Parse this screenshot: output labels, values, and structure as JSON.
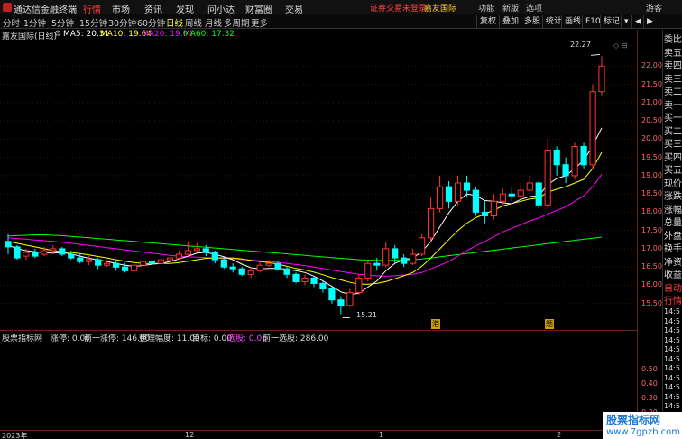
{
  "titlebar": {
    "app_title": "通达信金融终端",
    "menus": [
      "行情",
      "市场",
      "资讯",
      "发现",
      "问小达",
      "财富圈",
      "交易"
    ],
    "active_menu": "行情",
    "notice": "证券交易未登录",
    "notice2": "嘉友国际",
    "right_items": [
      "功能",
      "新版",
      "选项",
      "游客"
    ]
  },
  "toolbar": {
    "periods": [
      "分时",
      "1分钟",
      "5分钟",
      "15分钟",
      "30分钟",
      "60分钟",
      "日线",
      "周线",
      "月线",
      "多周期",
      "更多"
    ],
    "active_period": "日线",
    "buttons": [
      "复权",
      "叠加",
      "多股",
      "统计",
      "画线",
      "F10",
      "标记"
    ]
  },
  "legend": {
    "stock": "嘉友国际(日线)",
    "ma5": "MA5: 20.31",
    "ma10": "MA10: 19.64",
    "ma20": "MA20: 19.04",
    "ma60": "MA60: 17.32",
    "colors": {
      "ma5": "#ffffff",
      "ma10": "#ffff00",
      "ma20": "#ff00ff",
      "ma60": "#00ff00",
      "up": "#ff3232",
      "down": "#00ffff"
    }
  },
  "price_axis": {
    "ticks": [
      "22.00",
      "21.50",
      "21.00",
      "20.50",
      "20.00",
      "19.50",
      "19.00",
      "18.50",
      "18.00",
      "17.50",
      "17.00",
      "16.50",
      "16.00",
      "15.50"
    ],
    "ind_ticks": [
      "0.50",
      "0.40",
      "0.30",
      "0.20",
      "0.10"
    ]
  },
  "annotations": {
    "high": "22.27",
    "low": "15.21",
    "mark1": "港",
    "mark2": "题"
  },
  "indicator": {
    "name": "股票指标网",
    "zhangting": "涨停: 0.00",
    "qian_zhangting": "前一涨停: 146.00",
    "zhengli": "整理幅度: 11.00",
    "mubiao": "目标: 0.00",
    "xuangu": "选股: 0.00",
    "qian_xuangu": "前一选股: 286.00"
  },
  "bottom_axis": {
    "labels": [
      "2023年",
      "12",
      "1",
      "2"
    ]
  },
  "sidebar": {
    "items": [
      "委比",
      "卖五",
      "卖四",
      "卖三",
      "卖二",
      "卖一",
      "买一",
      "买二",
      "买三",
      "买四",
      "买五",
      "现价",
      "涨跌",
      "涨幅",
      "总量",
      "外盘",
      "换手",
      "净资",
      "收益",
      "自动",
      "行情"
    ],
    "times": [
      "14:5",
      "14:5",
      "14:5",
      "14:5",
      "14:5",
      "14:5",
      "14:5",
      "14:5",
      "14:5",
      "14:5",
      "14:5",
      "14:5",
      "14:5"
    ]
  },
  "watermark": {
    "line1": "股票指标网",
    "line2": "www.7gpzb.com"
  },
  "chart_data": {
    "type": "candlestick",
    "title": "嘉友国际(日线)",
    "y_range": [
      15.0,
      22.6
    ],
    "candles": [
      [
        17.2,
        17.05,
        17.4,
        16.85
      ],
      [
        17.05,
        16.75,
        17.1,
        16.7
      ],
      [
        16.8,
        16.9,
        17.0,
        16.7
      ],
      [
        16.9,
        16.8,
        17.0,
        16.75
      ],
      [
        16.85,
        16.95,
        17.05,
        16.8
      ],
      [
        16.95,
        17.0,
        17.1,
        16.85
      ],
      [
        17.0,
        16.85,
        17.05,
        16.8
      ],
      [
        16.85,
        16.75,
        16.95,
        16.7
      ],
      [
        16.75,
        16.65,
        16.85,
        16.6
      ],
      [
        16.65,
        16.7,
        16.8,
        16.55
      ],
      [
        16.7,
        16.55,
        16.75,
        16.45
      ],
      [
        16.55,
        16.6,
        16.7,
        16.5
      ],
      [
        16.6,
        16.5,
        16.65,
        16.4
      ],
      [
        16.5,
        16.4,
        16.6,
        16.35
      ],
      [
        16.4,
        16.55,
        16.6,
        16.3
      ],
      [
        16.55,
        16.65,
        16.75,
        16.5
      ],
      [
        16.65,
        16.6,
        16.75,
        16.5
      ],
      [
        16.6,
        16.7,
        16.8,
        16.55
      ],
      [
        16.7,
        16.75,
        16.85,
        16.65
      ],
      [
        16.75,
        16.85,
        16.95,
        16.7
      ],
      [
        16.85,
        16.95,
        17.2,
        16.8
      ],
      [
        16.95,
        17.0,
        17.15,
        16.9
      ],
      [
        17.0,
        16.9,
        17.1,
        16.8
      ],
      [
        16.9,
        16.7,
        16.95,
        16.6
      ],
      [
        16.7,
        16.5,
        16.75,
        16.45
      ],
      [
        16.5,
        16.45,
        16.6,
        16.35
      ],
      [
        16.45,
        16.3,
        16.5,
        16.25
      ],
      [
        16.3,
        16.4,
        16.5,
        16.2
      ],
      [
        16.4,
        16.55,
        16.65,
        16.35
      ],
      [
        16.55,
        16.6,
        16.7,
        16.5
      ],
      [
        16.6,
        16.45,
        16.65,
        16.4
      ],
      [
        16.45,
        16.3,
        16.5,
        16.2
      ],
      [
        16.3,
        16.1,
        16.35,
        16.05
      ],
      [
        16.1,
        16.2,
        16.3,
        16.0
      ],
      [
        16.2,
        16.05,
        16.25,
        15.95
      ],
      [
        16.05,
        15.9,
        16.1,
        15.8
      ],
      [
        15.9,
        15.6,
        15.95,
        15.5
      ],
      [
        15.6,
        15.45,
        15.7,
        15.21
      ],
      [
        15.45,
        15.8,
        15.9,
        15.4
      ],
      [
        15.8,
        16.2,
        16.3,
        15.75
      ],
      [
        16.2,
        16.6,
        16.7,
        16.1
      ],
      [
        16.6,
        16.55,
        16.75,
        16.4
      ],
      [
        16.55,
        17.0,
        17.2,
        16.5
      ],
      [
        17.0,
        16.75,
        17.1,
        16.6
      ],
      [
        16.75,
        16.6,
        16.85,
        16.5
      ],
      [
        16.6,
        16.85,
        17.0,
        16.55
      ],
      [
        16.85,
        17.3,
        17.4,
        16.8
      ],
      [
        17.3,
        18.1,
        18.4,
        17.2
      ],
      [
        18.1,
        18.7,
        19.0,
        18.0
      ],
      [
        18.7,
        18.3,
        18.85,
        18.1
      ],
      [
        18.3,
        18.8,
        19.0,
        18.2
      ],
      [
        18.8,
        18.6,
        19.0,
        18.4
      ],
      [
        18.6,
        18.0,
        18.7,
        17.9
      ],
      [
        18.0,
        17.9,
        18.3,
        17.7
      ],
      [
        17.9,
        18.3,
        18.5,
        17.8
      ],
      [
        18.3,
        18.5,
        18.65,
        18.2
      ],
      [
        18.5,
        18.45,
        18.7,
        18.3
      ],
      [
        18.45,
        18.6,
        18.8,
        18.35
      ],
      [
        18.6,
        18.8,
        19.0,
        18.5
      ],
      [
        18.8,
        18.2,
        18.85,
        18.1
      ],
      [
        18.2,
        19.7,
        20.0,
        18.1
      ],
      [
        19.7,
        19.3,
        19.8,
        19.0
      ],
      [
        19.3,
        19.0,
        19.5,
        18.8
      ],
      [
        19.0,
        19.8,
        19.9,
        18.9
      ],
      [
        19.8,
        19.3,
        19.9,
        19.2
      ],
      [
        19.3,
        21.3,
        21.5,
        19.2
      ],
      [
        21.3,
        22.0,
        22.27,
        21.2
      ]
    ],
    "ma5": [
      17.1,
      17.0,
      16.95,
      16.92,
      16.89,
      16.88,
      16.9,
      16.86,
      16.8,
      16.74,
      16.7,
      16.65,
      16.6,
      16.55,
      16.52,
      16.54,
      16.58,
      16.6,
      16.65,
      16.72,
      16.8,
      16.88,
      16.9,
      16.85,
      16.78,
      16.7,
      16.58,
      16.48,
      16.45,
      16.46,
      16.46,
      16.44,
      16.4,
      16.35,
      16.25,
      16.12,
      15.97,
      15.82,
      15.75,
      15.78,
      15.95,
      16.12,
      16.4,
      16.6,
      16.7,
      16.75,
      16.92,
      17.2,
      17.6,
      17.98,
      18.3,
      18.5,
      18.46,
      18.32,
      18.3,
      18.26,
      18.23,
      18.35,
      18.43,
      18.45,
      18.76,
      18.92,
      19.0,
      19.2,
      19.42,
      19.82,
      20.31
    ],
    "ma10": [
      17.2,
      17.15,
      17.1,
      17.05,
      17.0,
      16.95,
      16.92,
      16.9,
      16.87,
      16.83,
      16.79,
      16.75,
      16.7,
      16.66,
      16.62,
      16.6,
      16.6,
      16.6,
      16.6,
      16.62,
      16.66,
      16.7,
      16.74,
      16.75,
      16.75,
      16.75,
      16.72,
      16.68,
      16.65,
      16.62,
      16.58,
      16.52,
      16.46,
      16.42,
      16.36,
      16.29,
      16.21,
      16.15,
      16.08,
      16.03,
      16.03,
      16.05,
      16.1,
      16.18,
      16.26,
      16.35,
      16.52,
      16.75,
      17.0,
      17.25,
      17.5,
      17.7,
      17.85,
      17.95,
      18.06,
      18.17,
      18.24,
      18.3,
      18.36,
      18.39,
      18.55,
      18.63,
      18.7,
      18.8,
      18.9,
      19.2,
      19.64
    ],
    "ma20": [
      17.3,
      17.28,
      17.26,
      17.24,
      17.22,
      17.2,
      17.18,
      17.15,
      17.12,
      17.09,
      17.06,
      17.03,
      17.0,
      16.97,
      16.94,
      16.91,
      16.88,
      16.85,
      16.82,
      16.8,
      16.78,
      16.77,
      16.76,
      16.75,
      16.74,
      16.73,
      16.71,
      16.69,
      16.67,
      16.65,
      16.63,
      16.6,
      16.57,
      16.54,
      16.5,
      16.46,
      16.42,
      16.38,
      16.34,
      16.3,
      16.28,
      16.26,
      16.25,
      16.26,
      16.28,
      16.3,
      16.35,
      16.45,
      16.55,
      16.65,
      16.8,
      16.95,
      17.08,
      17.2,
      17.33,
      17.46,
      17.56,
      17.66,
      17.76,
      17.84,
      17.95,
      18.05,
      18.15,
      18.3,
      18.45,
      18.7,
      19.04
    ],
    "ma60": [
      17.35,
      17.36,
      17.37,
      17.38,
      17.38,
      17.37,
      17.36,
      17.34,
      17.32,
      17.3,
      17.28,
      17.26,
      17.24,
      17.22,
      17.2,
      17.18,
      17.16,
      17.14,
      17.12,
      17.1,
      17.08,
      17.06,
      17.04,
      17.02,
      17.0,
      16.98,
      16.96,
      16.94,
      16.92,
      16.9,
      16.88,
      16.86,
      16.84,
      16.82,
      16.8,
      16.78,
      16.76,
      16.74,
      16.72,
      16.7,
      16.69,
      16.68,
      16.68,
      16.68,
      16.69,
      16.7,
      16.72,
      16.75,
      16.78,
      16.81,
      16.84,
      16.87,
      16.9,
      16.93,
      16.96,
      16.99,
      17.02,
      17.05,
      17.08,
      17.11,
      17.14,
      17.17,
      17.2,
      17.23,
      17.26,
      17.29,
      17.32
    ]
  }
}
